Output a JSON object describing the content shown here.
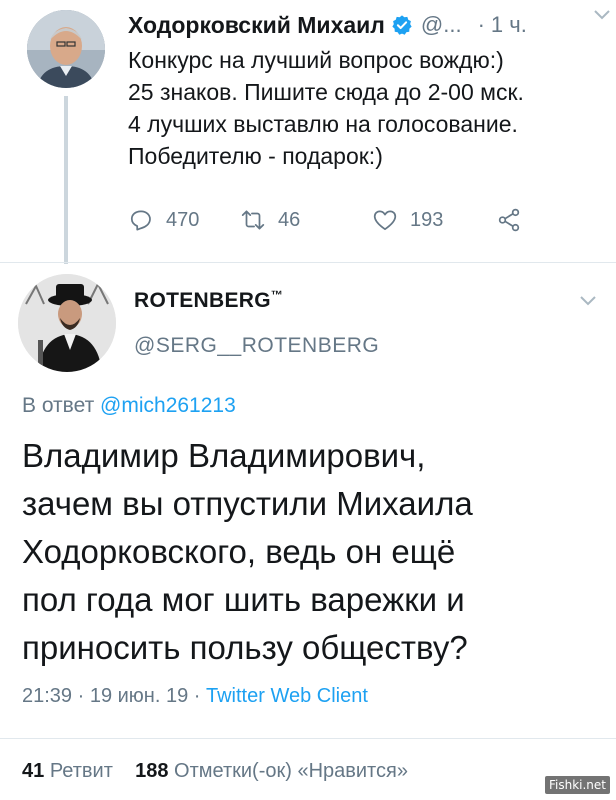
{
  "tweet1": {
    "author_name": "Ходорковский Михаил",
    "handle": "@...",
    "separator": "·",
    "time": "1 ч.",
    "lines": [
      "Конкурс на лучший вопрос вождю:)",
      "25 знаков. Пишите сюда до 2-00 мск.",
      "4 лучших выставлю на голосование.",
      "Победителю - подарок:)"
    ],
    "replies": "470",
    "retweets": "46",
    "likes": "193",
    "icons": [
      "verified-badge-icon",
      "chevron-down-icon",
      "reply-icon",
      "retweet-icon",
      "like-icon",
      "share-icon"
    ]
  },
  "tweet2": {
    "author_name": "ROTENBERG",
    "author_tm": "™",
    "handle": "@SERG__ROTENBERG",
    "reply_prefix": "В ответ",
    "reply_to": "@mich261213",
    "lines": [
      "Владимир Владимирович,",
      "зачем вы отпустили Михаила",
      "Ходорковского, ведь он ещё",
      "пол года мог шить варежки и",
      "приносить пользу обществу?"
    ],
    "meta_date": "21:39 · 19 июн. 19 ·",
    "meta_client": "Twitter Web Client",
    "retweet_count": "41",
    "retweet_label": "Ретвит",
    "like_count": "188",
    "like_label": "Отметки(-ок) «Нравится»"
  },
  "watermark": "Fishki.net",
  "colors": {
    "text": "#14171a",
    "secondary": "#657786",
    "link": "#1da1f2",
    "verified": "#1da1f2",
    "divider": "#e1e8ed"
  }
}
